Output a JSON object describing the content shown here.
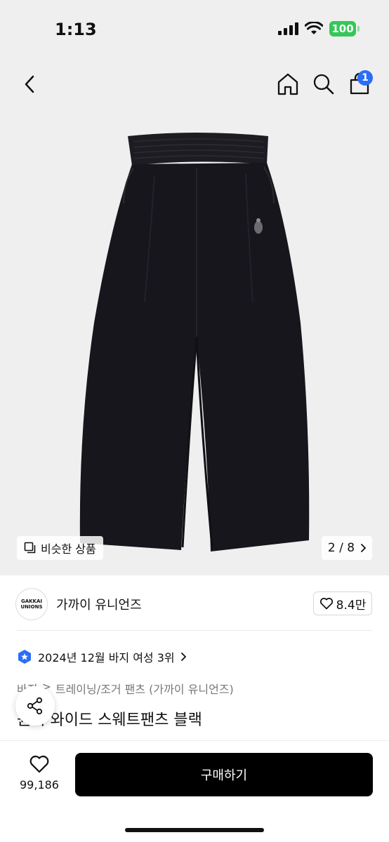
{
  "status_bar": {
    "time": "1:13",
    "battery": "100",
    "battery_color": "#34c759"
  },
  "nav": {
    "back_icon": "chevron-left-icon",
    "home_icon": "home-icon",
    "search_icon": "search-icon",
    "cart_icon": "cart-icon",
    "cart_badge": "1",
    "badge_color": "#2b6ef6"
  },
  "gallery": {
    "similar_label": "비슷한 상품",
    "page_indicator": "2 / 8",
    "background": "#efefef"
  },
  "brand": {
    "logo_line1": "GAKKAI",
    "logo_line2": "UNIONS",
    "name": "가까이 유니언즈",
    "likes": "8.4만"
  },
  "ranking": {
    "text": "2024년 12월 바지 여성 3위"
  },
  "breadcrumb": {
    "category": "바지",
    "separator": ">",
    "subcategory": "트레이닝/조거 팬츠 (가까이 유니언즈)"
  },
  "product": {
    "title": "원턱 와이드 스웨트팬츠 블랙"
  },
  "bottom_bar": {
    "wish_count": "99,186",
    "buy_label": "구매하기"
  }
}
